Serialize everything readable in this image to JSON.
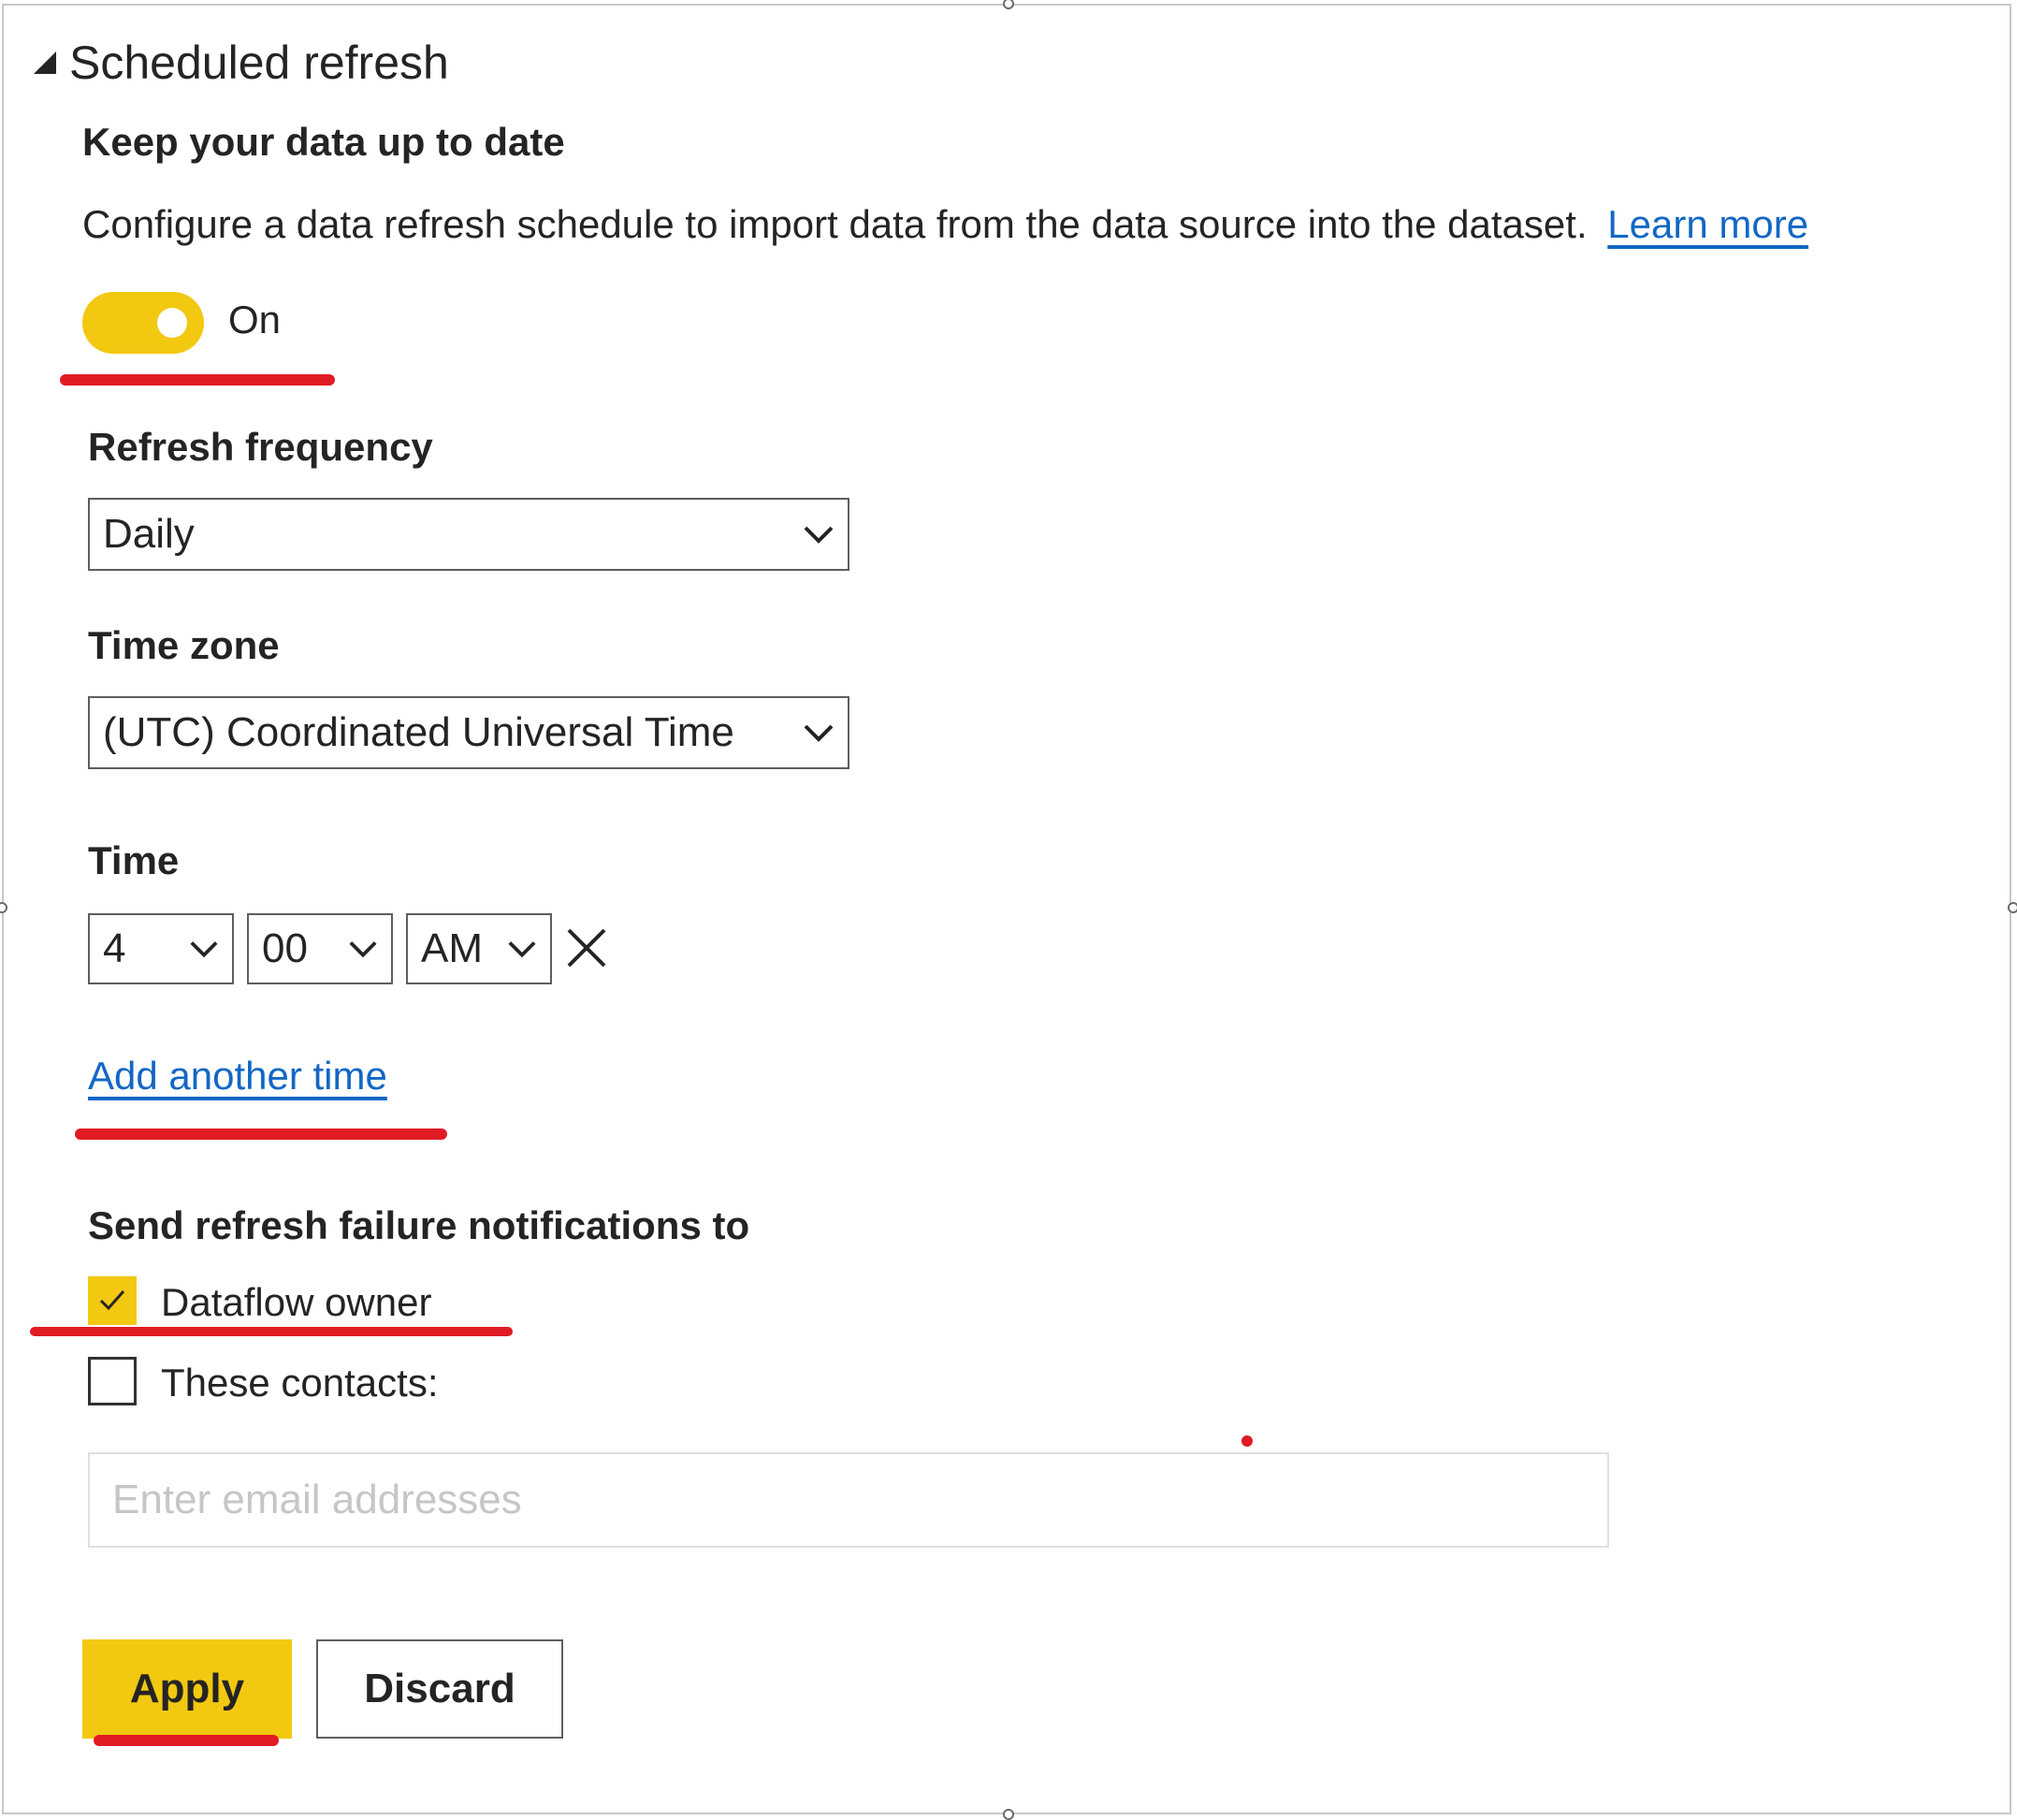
{
  "section": {
    "title": "Scheduled refresh"
  },
  "intro": {
    "heading": "Keep your data up to date",
    "description": "Configure a data refresh schedule to import data from the data source into the dataset.",
    "learn_more": "Learn more"
  },
  "toggle": {
    "state": "on",
    "label": "On"
  },
  "frequency": {
    "label": "Refresh frequency",
    "value": "Daily"
  },
  "timezone": {
    "label": "Time zone",
    "value": "(UTC) Coordinated Universal Time"
  },
  "time": {
    "label": "Time",
    "hour": "4",
    "minute": "00",
    "period": "AM",
    "add_another": "Add another time"
  },
  "notifications": {
    "heading": "Send refresh failure notifications to",
    "owner_label": "Dataflow owner",
    "owner_checked": true,
    "contacts_label": "These contacts:",
    "contacts_checked": false,
    "email_placeholder": "Enter email addresses"
  },
  "actions": {
    "apply": "Apply",
    "discard": "Discard"
  },
  "colors": {
    "accent": "#f2c811",
    "link": "#1267c5",
    "annotation": "#e01b24",
    "text": "#252423"
  },
  "icons": {
    "collapse": "triangle-down-left-icon",
    "dropdown": "chevron-down-icon",
    "clear": "close-icon",
    "check": "checkmark-icon"
  }
}
